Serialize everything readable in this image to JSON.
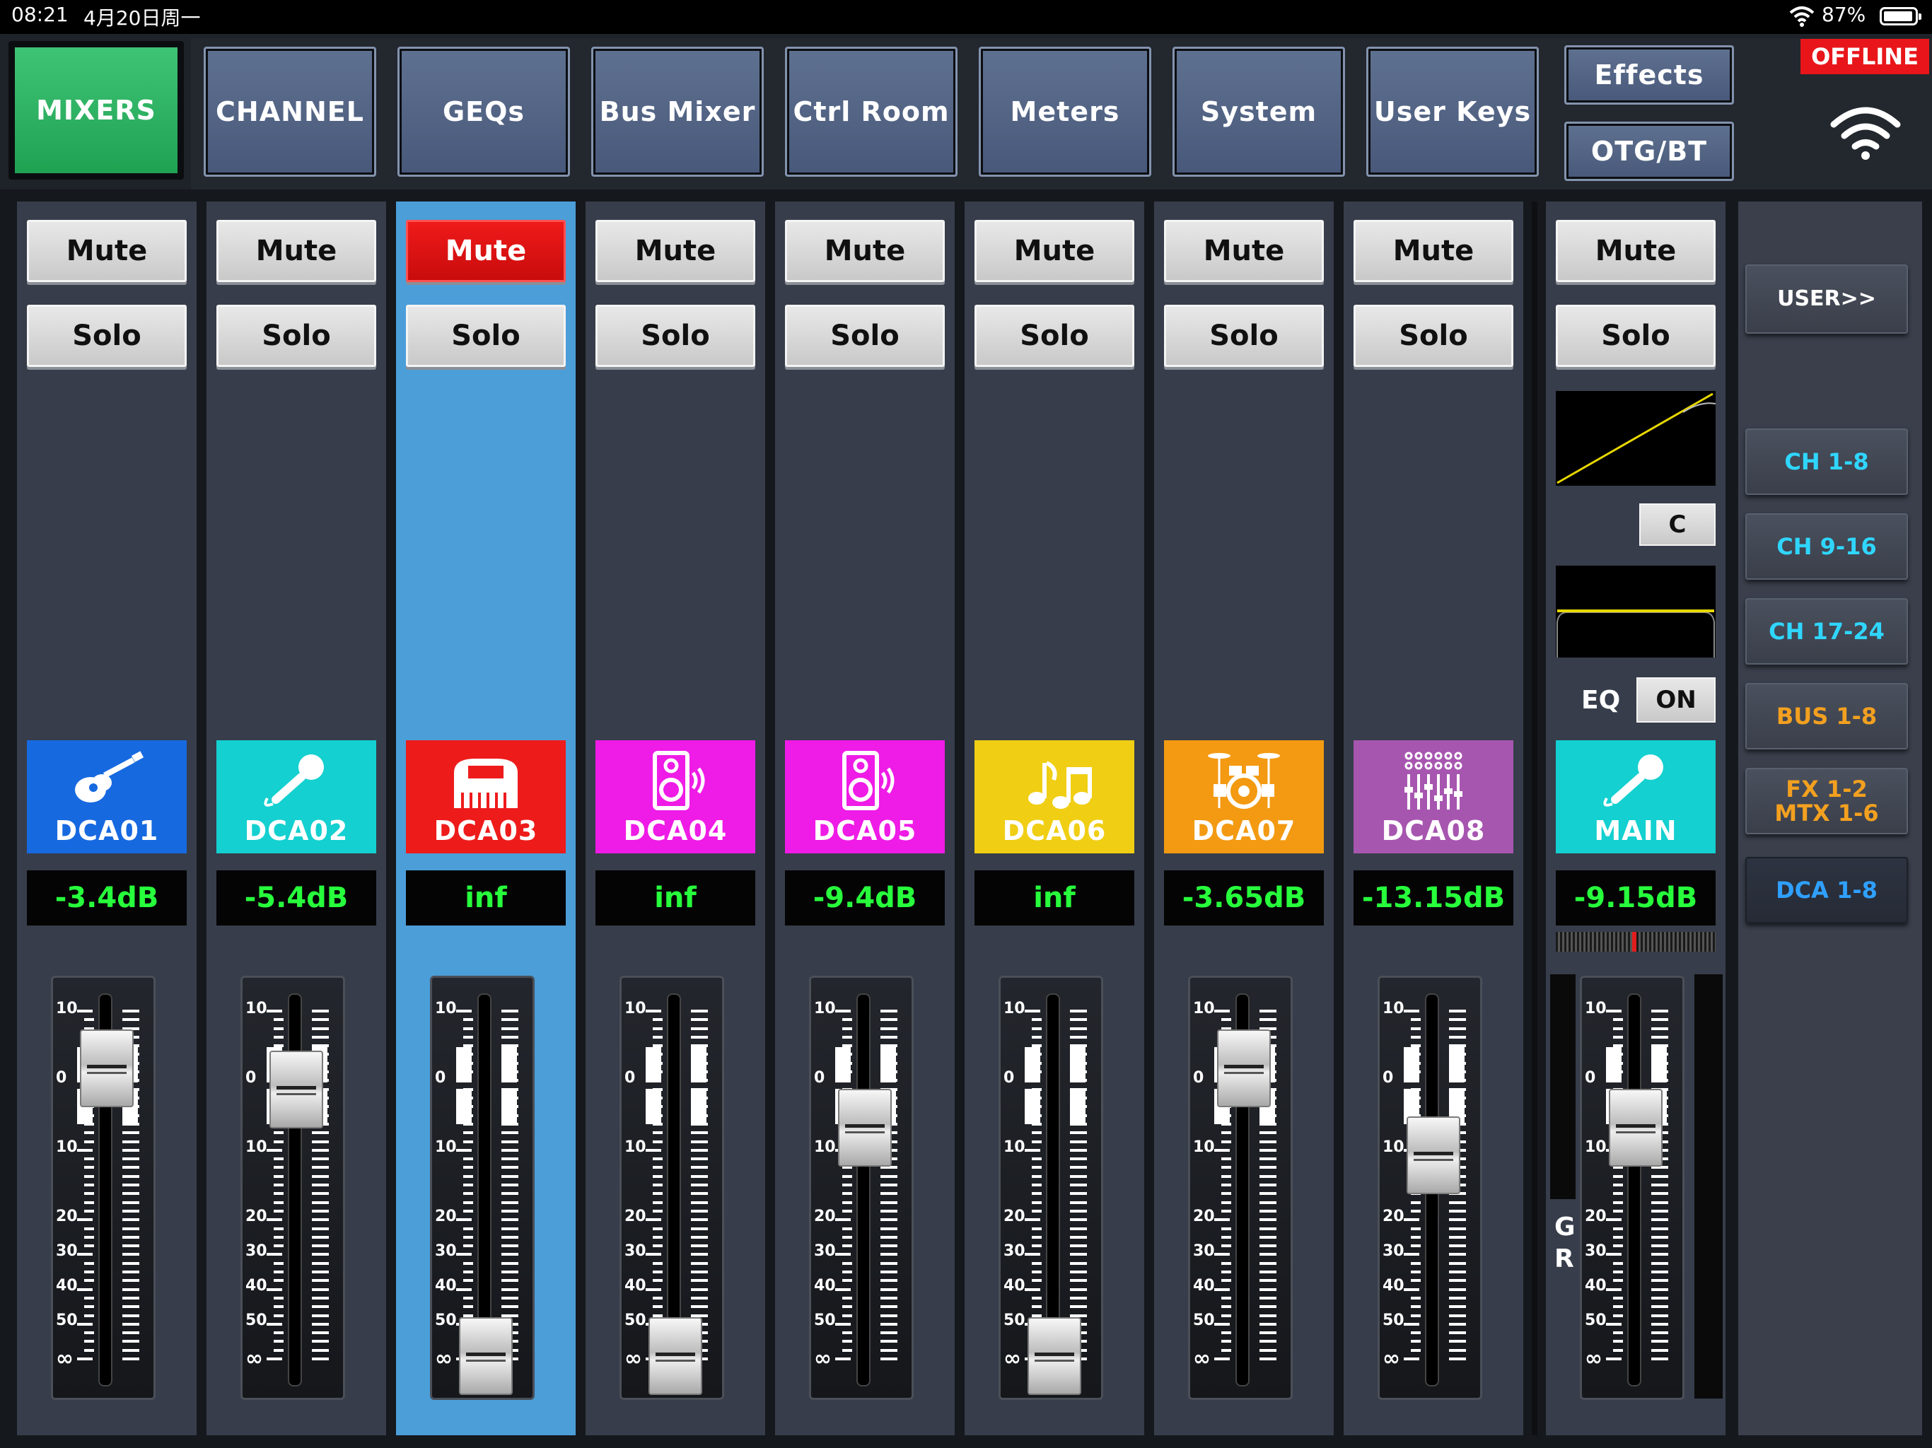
{
  "status_bar": {
    "time": "08:21",
    "date": "4月20日周一",
    "battery": "87%"
  },
  "nav": {
    "tabs": [
      {
        "label": "MIXERS",
        "active": true
      },
      {
        "label": "CHANNEL"
      },
      {
        "label": "GEQs"
      },
      {
        "label": "Bus Mixer"
      },
      {
        "label": "Ctrl Room"
      },
      {
        "label": "Meters"
      },
      {
        "label": "System"
      },
      {
        "label": "User Keys"
      }
    ],
    "effects_label": "Effects",
    "otg_label": "OTG/BT",
    "offline_label": "OFFLINE"
  },
  "strip_buttons": {
    "mute": "Mute",
    "solo": "Solo"
  },
  "scale": [
    "10",
    "0",
    "10",
    "20",
    "30",
    "40",
    "50",
    "∞"
  ],
  "strips": [
    {
      "name": "DCA01",
      "level": "-3.4dB",
      "icon": "guitar-icon",
      "color": "#1769e0",
      "fader_db": 1.5,
      "muted": false
    },
    {
      "name": "DCA02",
      "level": "-5.4dB",
      "icon": "microphone-icon",
      "color": "#14d0d0",
      "fader_db": -1.5,
      "muted": false
    },
    {
      "name": "DCA03",
      "level": "inf",
      "icon": "keyboard-icon",
      "color": "#ee1b1b",
      "fader_db": -99,
      "muted": true,
      "selected": true
    },
    {
      "name": "DCA04",
      "level": "inf",
      "icon": "speaker-icon",
      "color": "#ef1be6",
      "fader_db": -99,
      "muted": false
    },
    {
      "name": "DCA05",
      "level": "-9.4dB",
      "icon": "speaker-icon",
      "color": "#ef1be6",
      "fader_db": -7,
      "muted": false
    },
    {
      "name": "DCA06",
      "level": "inf",
      "icon": "music-notes-icon",
      "color": "#f0ce14",
      "fader_db": -99,
      "muted": false
    },
    {
      "name": "DCA07",
      "level": "-3.65dB",
      "icon": "drums-icon",
      "color": "#f39a12",
      "fader_db": 1.5,
      "muted": false
    },
    {
      "name": "DCA08",
      "level": "-13.15dB",
      "icon": "faders-icon",
      "color": "#a756b0",
      "fader_db": -11,
      "muted": false
    }
  ],
  "main": {
    "name": "MAIN",
    "level": "-9.15dB",
    "icon": "microphone-icon",
    "color": "#14d0d0",
    "fader_db": -7,
    "c_label": "C",
    "eq_label": "EQ",
    "eq_state": "ON",
    "gr_label_g": "G",
    "gr_label_r": "R"
  },
  "right_panel": [
    {
      "label": "USER>>",
      "color": "#ffffff"
    },
    {
      "label": "CH 1-8",
      "color": "#2fd6ff"
    },
    {
      "label": "CH 9-16",
      "color": "#2fd6ff"
    },
    {
      "label": "CH 17-24",
      "color": "#2fd6ff"
    },
    {
      "label": "BUS 1-8",
      "color": "#f3a020"
    },
    {
      "label": "FX 1-2\nMTX 1-6",
      "color": "#f3a020"
    },
    {
      "label": "DCA 1-8",
      "color": "#2fa0ff",
      "active": true
    }
  ]
}
